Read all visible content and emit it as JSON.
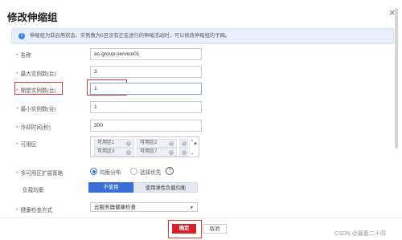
{
  "dialog": {
    "title": "修改伸缩组",
    "close_glyph": "×"
  },
  "info": {
    "icon": "!",
    "text": "伸缩组为非启用状态、实例数为0且没有正在进行的伸缩活动时，可以修改伸缩组的子网。"
  },
  "form": {
    "name": {
      "label": "名称",
      "value": "as-group-service01"
    },
    "max_instances": {
      "label": "最大实例数(台)",
      "value": "3"
    },
    "desired_instances": {
      "label": "期望实例数(台)",
      "value": "1"
    },
    "min_instances": {
      "label": "最小实例数(台)",
      "value": "1"
    },
    "cooldown": {
      "label": "冷却时间(秒)",
      "value": "300"
    },
    "availability_zone": {
      "label": "可用区",
      "tags": [
        "可用区1",
        "可用区2",
        "可用区3",
        "可用区7"
      ]
    },
    "az_strategy": {
      "label": "多可用区扩展策略",
      "options": [
        "均衡分布",
        "选择优先"
      ],
      "selected": "均衡分布"
    },
    "load_balancer": {
      "label": "负载均衡",
      "options": [
        "不使用",
        "使用弹性负载均衡"
      ],
      "selected": "不使用"
    },
    "health_check": {
      "label": "健康检查方式",
      "value": "云服务器健康检查"
    }
  },
  "footer": {
    "confirm": "确定",
    "cancel": "取消"
  },
  "watermark": "CSDN @暮春二十四",
  "colors": {
    "primary": "#3a6fd8",
    "danger": "#d6202c",
    "highlight_box": "#e23b3b"
  }
}
